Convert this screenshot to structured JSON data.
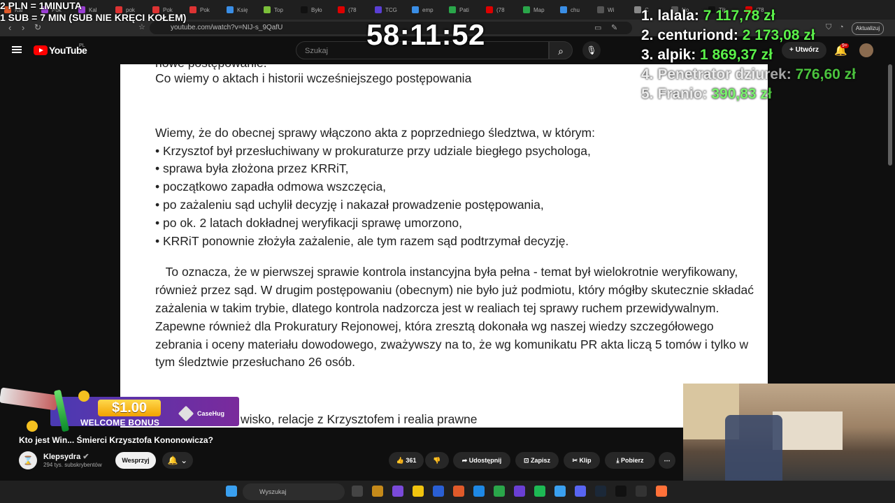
{
  "browser": {
    "url": "youtube.com/watch?v=NIJ-s_9QafU",
    "update_label": "Aktualizuj",
    "tabs": [
      "Kar",
      "Pok",
      "Kal",
      "pok",
      "Pok",
      "Pok",
      "Księ",
      "Top",
      "Było",
      "(78",
      "TCG",
      "emp",
      "Pati",
      "(78",
      "Map",
      "chu",
      "Wi",
      "C",
      "No",
      "Tik",
      "(78"
    ]
  },
  "youtube": {
    "logo_text": "YouTube",
    "country": "PL",
    "search_placeholder": "Szukaj",
    "create_label": "Utwórz",
    "notif_badge": "9+"
  },
  "document": {
    "cut_line": "nowe postępowanie.",
    "heading": "Co wiemy o aktach i historii wcześniejszego postępowania",
    "intro": "Wiemy, że do obecnej sprawy włączono akta z poprzedniego śledztwa, w którym:",
    "bullets": [
      "• Krzysztof był przesłuchiwany w prokuraturze przy udziale biegłego psychologa,",
      "• sprawa była złożona przez KRRiT,",
      "• początkowo zapadła odmowa wszczęcia,",
      "• po zażaleniu sąd uchylił decyzję i nakazał prowadzenie postępowania,",
      "• po ok. 2 latach dokładnej weryfikacji sprawę umorzono,",
      "• KRRiT ponownie złożyła zażalenie, ale tym razem sąd podtrzymał decyzję."
    ],
    "paragraph": "   To oznacza, że w pierwszej sprawie kontrola instancyjna była pełna - temat był wielokrotnie weryfikowany, również przez sąd. W drugim postępowaniu (obecnym) nie było już podmiotu, który mógłby skutecznie składać zażalenia w takim trybie, dlatego kontrola nadzorcza jest w realiach tej sprawy ruchem przewidywalnym. Zapewne również dla Prokuratury Rejonowej, która zresztą dokonała wg naszej wiedzy szczegółowego zebrania i oceny materiału dowodowego, zważywszy na to, że wg komunikatu PR akta liczą 5 tomów i tylko w tym śledztwie przesłuchano 26 osób.",
    "partial_heading": "wisko, relacje z Krzysztofem i realia prawne"
  },
  "video_info": {
    "title": "Kto jest Win... Śmierci Krzysztofa Kononowicza?",
    "channel": "Klepsydra",
    "subscribers": "294 tys. subskrybentów",
    "support_label": "Wesprzyj",
    "likes": "361",
    "share_label": "Udostępnij",
    "save_label": "Zapisz",
    "clip_label": "Klip",
    "download_label": "Pobierz"
  },
  "ad": {
    "amount": "$1.00",
    "text": "WELCOME BONUS",
    "brand": "CaseHug"
  },
  "overlay": {
    "rate_line1": "2 PLN = 1MINUTA",
    "rate_line2": "1 SUB = 7 MIN (SUB NIE KRĘCI KOŁEM)",
    "timer": "58:11:52",
    "leaderboard": [
      {
        "name": "1. lalala:",
        "amount": "7 117,78 zł"
      },
      {
        "name": "2. centuriond:",
        "amount": "2 173,08 zł"
      },
      {
        "name": "3. alpik:",
        "amount": "1 869,37 zł"
      },
      {
        "name": "4. Penetrator dziurek:",
        "amount": "776,60 zł"
      },
      {
        "name": "5. Franio:",
        "amount": "390,83 zł"
      }
    ]
  },
  "taskbar": {
    "search_placeholder": "Wyszukaj"
  },
  "colors": {
    "leaderboard_amount": "#5bf14a",
    "youtube_red": "#ff0000",
    "bg_dark": "#0f0f0f"
  }
}
